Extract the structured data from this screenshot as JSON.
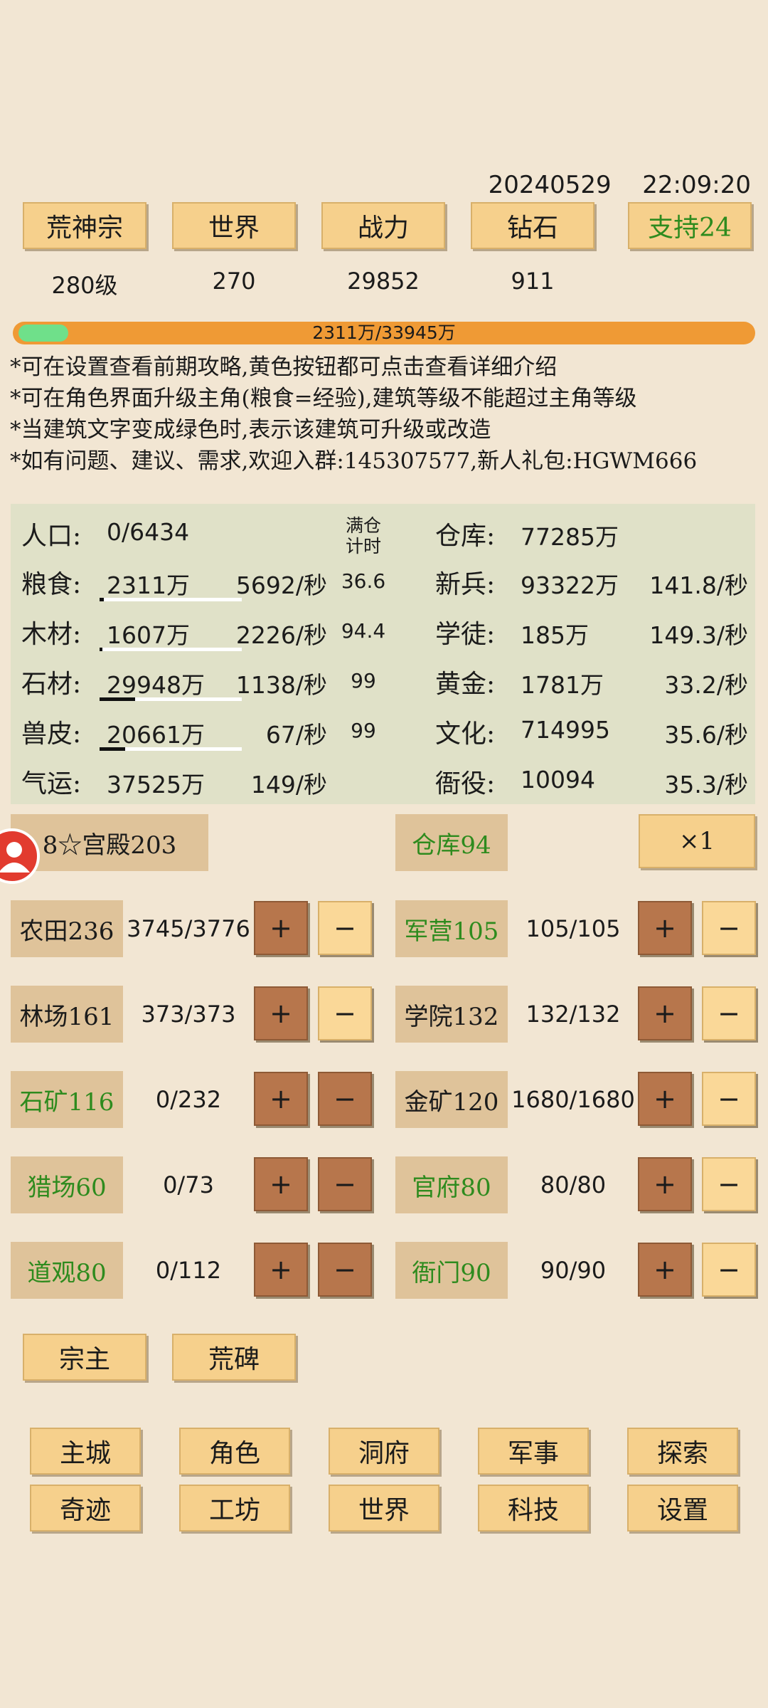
{
  "datetime": {
    "date": "20240529",
    "time": "22:09:20"
  },
  "top_buttons": [
    {
      "label": "荒神宗",
      "value": "280级",
      "green": false
    },
    {
      "label": "世界",
      "value": "270",
      "green": false
    },
    {
      "label": "战力",
      "value": "29852",
      "green": false
    },
    {
      "label": "钻石",
      "value": "911",
      "green": false
    },
    {
      "label": "支持24",
      "value": "",
      "green": true
    }
  ],
  "progress": {
    "text": "2311万/33945万",
    "fraction": 0.068,
    "fill_color": "#6fe08a",
    "track_color": "#ef9a35"
  },
  "notes": [
    "*可在设置查看前期攻略,黄色按钮都可点击查看详细介绍",
    "*可在角色界面升级主角(粮食=经验),建筑等级不能超过主角等级",
    "*当建筑文字变成绿色时,表示该建筑可升级或改造",
    "*如有问题、建议、需求,欢迎入群:145307577,新人礼包:HGWM666"
  ],
  "resources": {
    "population": {
      "label": "人口:",
      "value": "0/6434"
    },
    "full_timer": {
      "line1": "满仓",
      "line2": "计时"
    },
    "warehouse": {
      "label": "仓库:",
      "value": "77285万"
    },
    "left": [
      {
        "label": "粮食:",
        "value": "2311万",
        "rate": "5692/秒",
        "timer": "36.6",
        "fill": 0.03
      },
      {
        "label": "木材:",
        "value": "1607万",
        "rate": "2226/秒",
        "timer": "94.4",
        "fill": 0.02
      },
      {
        "label": "石材:",
        "value": "29948万",
        "rate": "1138/秒",
        "timer": "99",
        "fill": 0.25
      },
      {
        "label": "兽皮:",
        "value": "20661万",
        "rate": "67/秒",
        "timer": "99",
        "fill": 0.18
      },
      {
        "label": "气运:",
        "value": "37525万",
        "rate": "149/秒",
        "timer": "",
        "fill": null
      }
    ],
    "right": [
      {
        "label": "新兵:",
        "value": "93322万",
        "rate": "141.8/秒"
      },
      {
        "label": "学徒:",
        "value": "185万",
        "rate": "149.3/秒"
      },
      {
        "label": "黄金:",
        "value": "1781万",
        "rate": "33.2/秒"
      },
      {
        "label": "文化:",
        "value": "714995",
        "rate": "35.6/秒"
      },
      {
        "label": "衙役:",
        "value": "10094",
        "rate": "35.3/秒"
      }
    ]
  },
  "palace": {
    "label": "8☆宫殿203"
  },
  "warehouse_btn": {
    "label": "仓库94"
  },
  "multiplier": {
    "label": "×1"
  },
  "plus_label": "+",
  "minus_label": "−",
  "buildings_left": [
    {
      "name": "农田236",
      "count": "3745/3776",
      "green": false,
      "minus_dark": false
    },
    {
      "name": "林场161",
      "count": "373/373",
      "green": false,
      "minus_dark": false
    },
    {
      "name": "石矿116",
      "count": "0/232",
      "green": true,
      "minus_dark": true
    },
    {
      "name": "猎场60",
      "count": "0/73",
      "green": true,
      "minus_dark": true
    },
    {
      "name": "道观80",
      "count": "0/112",
      "green": true,
      "minus_dark": true
    }
  ],
  "buildings_right": [
    {
      "name": "军营105",
      "count": "105/105",
      "green": true
    },
    {
      "name": "学院132",
      "count": "132/132",
      "green": false
    },
    {
      "name": "金矿120",
      "count": "1680/1680",
      "green": false
    },
    {
      "name": "官府80",
      "count": "80/80",
      "green": true
    },
    {
      "name": "衙门90",
      "count": "90/90",
      "green": true
    }
  ],
  "extra_buttons": [
    "宗主",
    "荒碑"
  ],
  "nav_row1": [
    "主城",
    "角色",
    "洞府",
    "军事",
    "探索"
  ],
  "nav_row2": [
    "奇迹",
    "工坊",
    "世界",
    "科技",
    "设置"
  ]
}
